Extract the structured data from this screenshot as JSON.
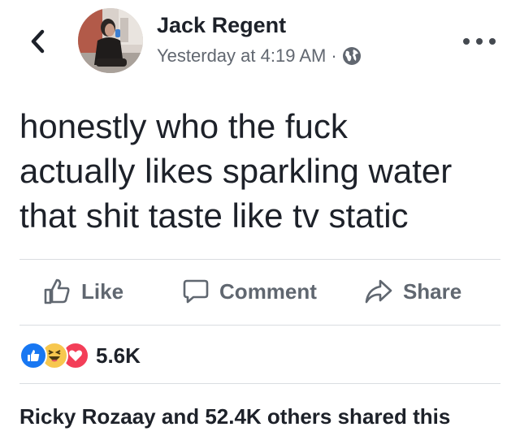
{
  "header": {
    "author": "Jack Regent",
    "timestamp": "Yesterday at 4:19 AM",
    "separator": "·",
    "privacy_icon": "globe-icon",
    "back_icon": "chevron-left-icon",
    "more_icon": "more-dots-icon"
  },
  "post": {
    "lines": [
      "honestly who the fuck",
      "actually likes sparkling water",
      "that shit taste like tv static"
    ]
  },
  "actions": {
    "like_label": "Like",
    "comment_label": "Comment",
    "share_label": "Share"
  },
  "reactions": {
    "icons": [
      "like-reaction-icon",
      "haha-reaction-icon",
      "love-reaction-icon"
    ],
    "count": "5.6K"
  },
  "shares": {
    "text": "Ricky Rozaay and 52.4K others shared this"
  },
  "colors": {
    "like_blue": "#1877f2",
    "love_red": "#f33e58",
    "haha_yellow": "#f7c74e",
    "secondary_text": "#606770"
  }
}
